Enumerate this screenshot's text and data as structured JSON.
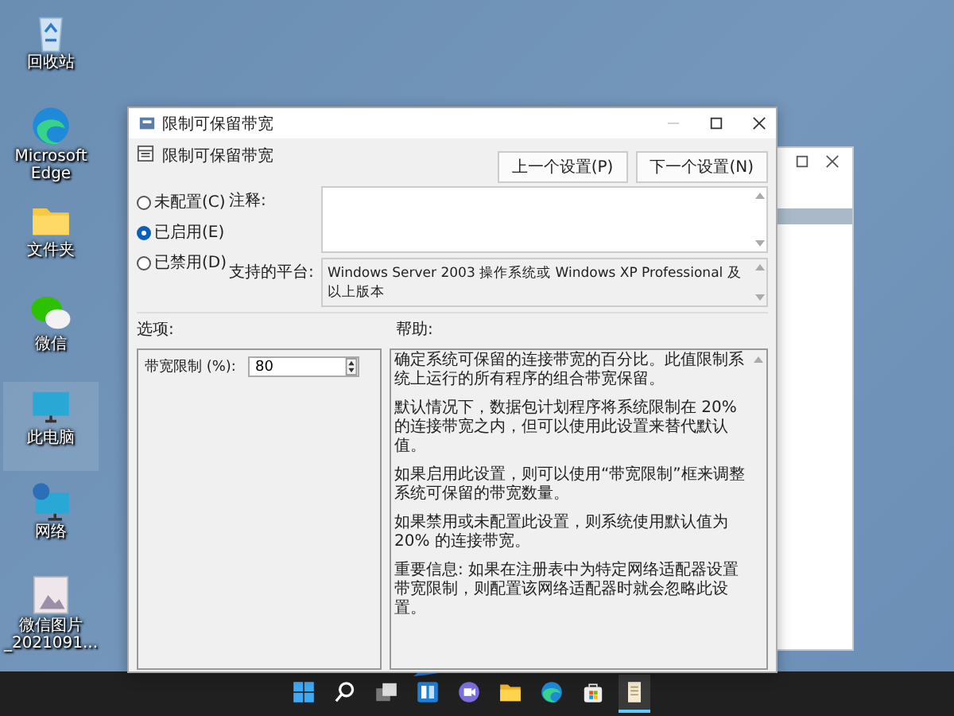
{
  "desktop_icons": [
    {
      "kind": "recycle",
      "label": "回收站",
      "selected": false
    },
    {
      "kind": "edge",
      "label": "Microsoft Edge",
      "selected": false
    },
    {
      "kind": "folder",
      "label": "文件夹",
      "selected": false
    },
    {
      "kind": "chat",
      "label": "微信",
      "selected": false
    },
    {
      "kind": "monitor",
      "label": "此电脑",
      "selected": true
    },
    {
      "kind": "network",
      "label": "网络",
      "selected": false
    },
    {
      "kind": "image",
      "label": "微信图片_2021091...",
      "selected": false
    }
  ],
  "dialog": {
    "title": "限制可保留带宽",
    "policy_name": "限制可保留带宽",
    "buttons": [
      "上一个设置(P)",
      "下一个设置(N)"
    ],
    "options": [
      {
        "label": "未配置(C)",
        "selected": false
      },
      {
        "label": "已启用(E)",
        "selected": true
      },
      {
        "label": "已禁用(D)",
        "selected": false
      }
    ],
    "comment_label": "注释:",
    "platform_label": "支持的平台:",
    "platform_text": "Windows Server 2003 操作系统或 Windows XP Professional 及以上版本",
    "options_heading": "选项:",
    "help_heading": "帮助:",
    "bandwidth_field": {
      "label": "带宽限制 (%):",
      "value": "80"
    },
    "help_paragraphs": [
      "确定系统可保留的连接带宽的百分比。此值限制系统上运行的所有程序的组合带宽保留。",
      "默认情况下，数据包计划程序将系统限制在 20% 的连接带宽之内，但可以使用此设置来替代默认值。",
      "如果启用此设置，则可以使用“带宽限制”框来调整系统可保留的带宽数量。",
      "如果禁用或未配置此设置，则系统使用默认值为 20% 的连接带宽。",
      "重要信息: 如果在注册表中为特定网络适配器设置带宽限制，则配置该网络适配器时就会忽略此设置。"
    ]
  },
  "taskbar": {
    "apps": [
      {
        "kind": "start",
        "active": false
      },
      {
        "kind": "search",
        "active": false
      },
      {
        "kind": "taskview",
        "active": false
      },
      {
        "kind": "widgets",
        "active": false
      },
      {
        "kind": "chat",
        "active": false
      },
      {
        "kind": "explorer",
        "active": false
      },
      {
        "kind": "edge",
        "active": false
      },
      {
        "kind": "store",
        "active": false
      },
      {
        "kind": "notepad",
        "active": true
      }
    ]
  }
}
